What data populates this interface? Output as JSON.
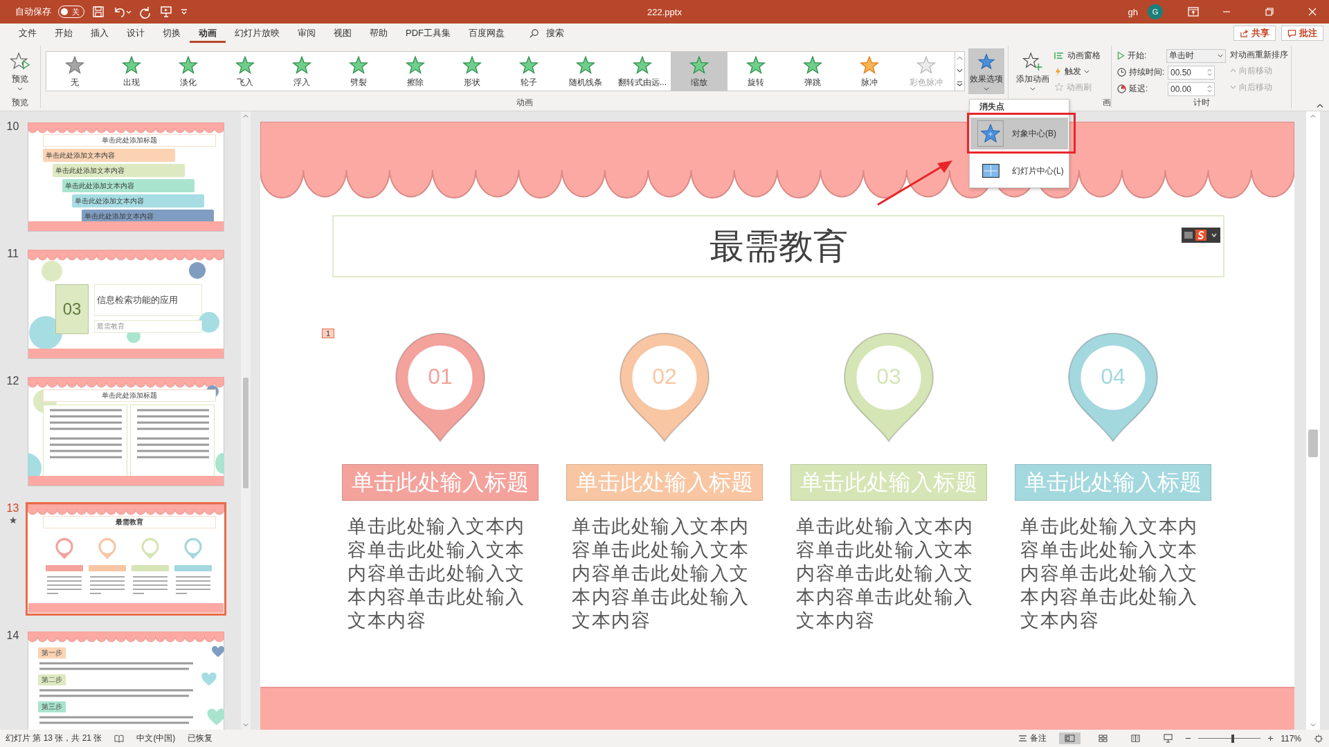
{
  "title_bar": {
    "autosave_label": "自动保存",
    "autosave": {
      "on": false,
      "label": "关"
    },
    "file_name": "222.pptx",
    "user": "gh",
    "avatar": "G"
  },
  "menu_tabs": [
    {
      "label": "文件",
      "selected": false
    },
    {
      "label": "开始",
      "selected": false
    },
    {
      "label": "插入",
      "selected": false
    },
    {
      "label": "设计",
      "selected": false
    },
    {
      "label": "切换",
      "selected": false
    },
    {
      "label": "动画",
      "selected": true
    },
    {
      "label": "幻灯片放映",
      "selected": false
    },
    {
      "label": "审阅",
      "selected": false
    },
    {
      "label": "视图",
      "selected": false
    },
    {
      "label": "帮助",
      "selected": false
    },
    {
      "label": "PDF工具集",
      "selected": false
    },
    {
      "label": "百度网盘",
      "selected": false
    }
  ],
  "search": {
    "label": "搜索"
  },
  "share": "共享",
  "comments": "批注",
  "preview": {
    "label": "预览",
    "group": "预览"
  },
  "animations": [
    {
      "label": "无",
      "kind": "none",
      "selected": false,
      "disabled": false
    },
    {
      "label": "出现",
      "kind": "entrance",
      "selected": false,
      "disabled": false
    },
    {
      "label": "淡化",
      "kind": "entrance",
      "selected": false,
      "disabled": false
    },
    {
      "label": "飞入",
      "kind": "entrance",
      "selected": false,
      "disabled": false
    },
    {
      "label": "浮入",
      "kind": "entrance",
      "selected": false,
      "disabled": false
    },
    {
      "label": "劈裂",
      "kind": "entrance",
      "selected": false,
      "disabled": false
    },
    {
      "label": "擦除",
      "kind": "entrance",
      "selected": false,
      "disabled": false
    },
    {
      "label": "形状",
      "kind": "entrance",
      "selected": false,
      "disabled": false
    },
    {
      "label": "轮子",
      "kind": "entrance",
      "selected": false,
      "disabled": false
    },
    {
      "label": "随机线条",
      "kind": "entrance",
      "selected": false,
      "disabled": false
    },
    {
      "label": "翻转式由远...",
      "kind": "entrance",
      "selected": false,
      "disabled": false
    },
    {
      "label": "缩放",
      "kind": "entrance",
      "selected": true,
      "disabled": false
    },
    {
      "label": "旋转",
      "kind": "entrance",
      "selected": false,
      "disabled": false
    },
    {
      "label": "弹跳",
      "kind": "entrance",
      "selected": false,
      "disabled": false
    },
    {
      "label": "脉冲",
      "kind": "emphasis",
      "selected": false,
      "disabled": false
    },
    {
      "label": "彩色脉冲",
      "kind": "emphasis",
      "selected": false,
      "disabled": true
    }
  ],
  "animation_group": "动画",
  "effect_options": {
    "label": "效果选项",
    "expanded": true
  },
  "advanced": {
    "add_animation": "添加动画",
    "pane": "动画窗格",
    "trigger": "触发",
    "painter": {
      "label": "动画刷",
      "disabled": true
    },
    "group": "画"
  },
  "timing": {
    "start_label": "开始:",
    "start_value": "单击时",
    "duration_label": "持续时间:",
    "duration": "00.50",
    "delay_label": "延迟:",
    "delay": "00.00",
    "reorder": "对动画重新排序",
    "forward": {
      "label": "向前移动",
      "disabled": true
    },
    "backward": {
      "label": "向后移动",
      "disabled": true
    },
    "group": "计时"
  },
  "dropdown": {
    "header": "消失点",
    "items": [
      {
        "label": "对象中心(B)",
        "selected": true
      },
      {
        "label": "幻灯片中心(L)",
        "selected": false
      }
    ]
  },
  "thumbnails": [
    {
      "number": "10",
      "kind": "steps",
      "selected": false,
      "animated": false,
      "title": "单击此处添加标题",
      "bars": [
        {
          "label": "单击此处添加文本内容",
          "color": "#fbd3b3"
        },
        {
          "label": "单击此处添加文本内容",
          "color": "#dde9c0"
        },
        {
          "label": "单击此处添加文本内容",
          "color": "#a9e4cf"
        },
        {
          "label": "单击此处添加文本内容",
          "color": "#a6dde3"
        },
        {
          "label": "单击此处添加文本内容",
          "color": "#7f9dc1"
        }
      ]
    },
    {
      "number": "11",
      "kind": "section",
      "selected": false,
      "animated": false,
      "section_number": "03",
      "title": "信息检索功能的应用",
      "subtitle": "最需教育"
    },
    {
      "number": "12",
      "kind": "columns",
      "selected": false,
      "animated": false,
      "title": "单击此处添加标题"
    },
    {
      "number": "13",
      "kind": "pins",
      "selected": true,
      "animated": true,
      "title": "最需教育"
    },
    {
      "number": "14",
      "kind": "steps-list",
      "selected": false,
      "animated": false,
      "steps": [
        {
          "label": "第一步",
          "color": "#fbd3b3"
        },
        {
          "label": "第二步",
          "color": "#dde9c0"
        },
        {
          "label": "第三步",
          "color": "#a9e4cf"
        }
      ]
    }
  ],
  "slide": {
    "title": "最需教育",
    "animation_tag": "1",
    "items": [
      {
        "number": "01",
        "heading": "单击此处输入标题",
        "body": "单击此处输入文本内容单击此处输入文本内容单击此处输入文本内容单击此处输入文本内容",
        "color": "#f4a29c"
      },
      {
        "number": "02",
        "heading": "单击此处输入标题",
        "body": "单击此处输入文本内容单击此处输入文本内容单击此处输入文本内容单击此处输入文本内容",
        "color": "#f8c6a3"
      },
      {
        "number": "03",
        "heading": "单击此处输入标题",
        "body": "单击此处输入文本内容单击此处输入文本内容单击此处输入文本内容单击此处输入文本内容",
        "color": "#d5e5b5"
      },
      {
        "number": "04",
        "heading": "单击此处输入标题",
        "body": "单击此处输入文本内容单击此处输入文本内容单击此处输入文本内容单击此处输入文本内容",
        "color": "#a3d8de"
      }
    ]
  },
  "status_bar": {
    "slide_info": "幻灯片 第 13 张，共 21 张",
    "language": "中文(中国)",
    "recovery": "已恢复",
    "notes": "备注",
    "zoom": {
      "level": 0.55,
      "label": "117%"
    }
  }
}
